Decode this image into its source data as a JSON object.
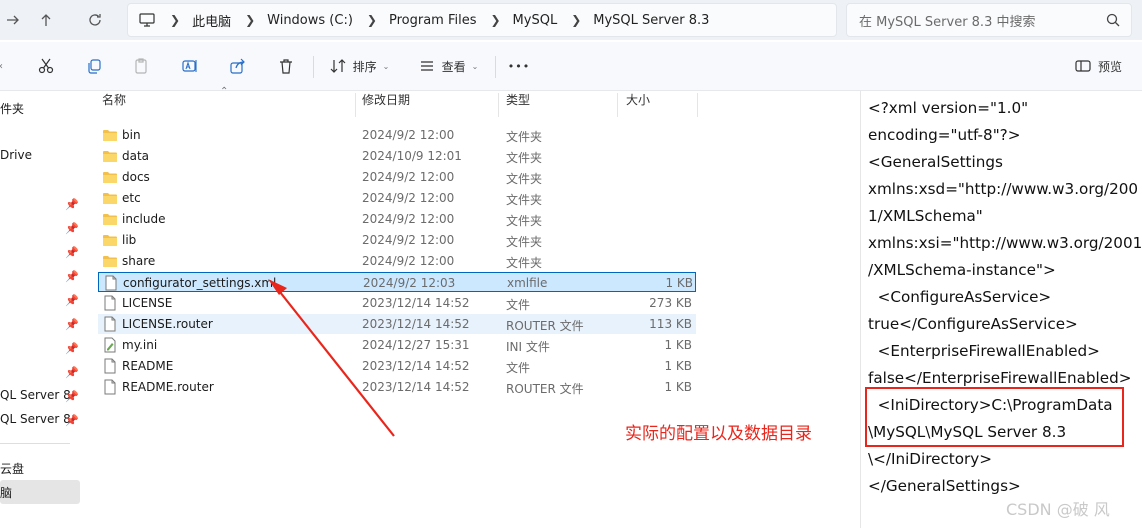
{
  "address": {
    "breadcrumbs": [
      "此电脑",
      "Windows (C:)",
      "Program Files",
      "MySQL",
      "MySQL Server 8.3"
    ]
  },
  "search": {
    "placeholder": "在 MySQL Server 8.3 中搜索"
  },
  "toolbar": {
    "sort_label": "排序",
    "view_label": "查看",
    "more_label": "•••",
    "preview_label": "预览"
  },
  "nav": {
    "items": [
      "件夹",
      "Drive",
      "QL Server 8",
      "QL Server 8",
      "云盘",
      "脑"
    ]
  },
  "columns": {
    "name": "名称",
    "date": "修改日期",
    "type": "类型",
    "size": "大小"
  },
  "files": [
    {
      "name": "bin",
      "date": "2024/9/2 12:00",
      "type": "文件夹",
      "size": "",
      "icon": "folder-icon"
    },
    {
      "name": "data",
      "date": "2024/10/9 12:01",
      "type": "文件夹",
      "size": "",
      "icon": "folder-icon"
    },
    {
      "name": "docs",
      "date": "2024/9/2 12:00",
      "type": "文件夹",
      "size": "",
      "icon": "folder-icon"
    },
    {
      "name": "etc",
      "date": "2024/9/2 12:00",
      "type": "文件夹",
      "size": "",
      "icon": "folder-icon"
    },
    {
      "name": "include",
      "date": "2024/9/2 12:00",
      "type": "文件夹",
      "size": "",
      "icon": "folder-icon"
    },
    {
      "name": "lib",
      "date": "2024/9/2 12:00",
      "type": "文件夹",
      "size": "",
      "icon": "folder-icon"
    },
    {
      "name": "share",
      "date": "2024/9/2 12:00",
      "type": "文件夹",
      "size": "",
      "icon": "folder-icon"
    },
    {
      "name": "configurator_settings.xml",
      "date": "2024/9/2 12:03",
      "type": "xmlfile",
      "size": "1 KB",
      "icon": "file-icon"
    },
    {
      "name": "LICENSE",
      "date": "2023/12/14 14:52",
      "type": "文件",
      "size": "273 KB",
      "icon": "file-icon"
    },
    {
      "name": "LICENSE.router",
      "date": "2023/12/14 14:52",
      "type": "ROUTER 文件",
      "size": "113 KB",
      "icon": "file-icon"
    },
    {
      "name": "my.ini",
      "date": "2024/12/27 15:31",
      "type": "INI 文件",
      "size": "1 KB",
      "icon": "ini-file-icon"
    },
    {
      "name": "README",
      "date": "2023/12/14 14:52",
      "type": "文件",
      "size": "1 KB",
      "icon": "file-icon"
    },
    {
      "name": "README.router",
      "date": "2023/12/14 14:52",
      "type": "ROUTER 文件",
      "size": "1 KB",
      "icon": "file-icon"
    }
  ],
  "preview": {
    "lines": [
      "<?xml version=\"1.0\"",
      "encoding=\"utf-8\"?>",
      "<GeneralSettings",
      "xmlns:xsd=\"http://www.w3.org/200",
      "1/XMLSchema\"",
      "xmlns:xsi=\"http://www.w3.org/2001",
      "/XMLSchema-instance\">",
      "  <ConfigureAsService>",
      "true</ConfigureAsService>",
      "  <EnterpriseFirewallEnabled>",
      "false</EnterpriseFirewallEnabled>",
      "  <IniDirectory>C:\\ProgramData",
      "\\MySQL\\MySQL Server 8.3",
      "\\</IniDirectory>",
      "</GeneralSettings>"
    ]
  },
  "annotation": {
    "text": "实际的配置以及数据目录",
    "color": "#e8261c"
  },
  "watermark": "CSDN @破 风"
}
